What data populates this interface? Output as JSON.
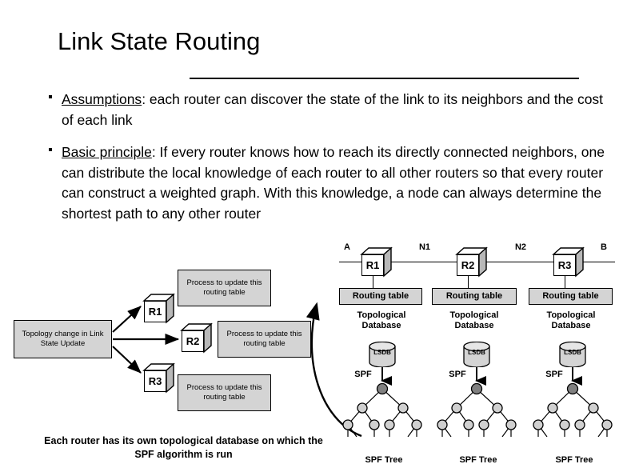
{
  "slide": {
    "title": "Link State Routing",
    "bullets": [
      {
        "lead": "Assumptions",
        "rest": ": each router can discover the state of the link to its neighbors and the cost of each link"
      },
      {
        "lead": "Basic principle",
        "rest": ": If every router knows how to reach its directly connected neighbors, one can distribute the local knowledge of each router to all other routers so that every router can construct a weighted graph. With this knowledge, a node can always determine the shortest path to any other router"
      }
    ]
  },
  "left_diagram": {
    "source_box": "Topology change in Link State Update",
    "routers": [
      {
        "label": "R1",
        "process": "Process to update this routing table"
      },
      {
        "label": "R2",
        "process": "Process to update this routing table"
      },
      {
        "label": "R3",
        "process": "Process to update this routing table"
      }
    ],
    "caption": "Each router has its own topological database on which the SPF algorithm is run"
  },
  "right_diagram": {
    "network_labels": [
      "A",
      "N1",
      "N2",
      "B"
    ],
    "routers": [
      "R1",
      "R2",
      "R3"
    ],
    "routing_table_label": "Routing table",
    "database_label": "Topological Database",
    "database_title_line1": "Topological",
    "database_title_line2": "Database",
    "lsdb_label": "LSDB",
    "spf_label": "SPF",
    "spf_tree_label": "SPF Tree",
    "columns": [
      {
        "router": "R1",
        "routing_table": "Routing table",
        "db_line1": "Topological",
        "db_line2": "Database",
        "lsdb": "LSDB",
        "spf": "SPF",
        "tree": "SPF Tree"
      },
      {
        "router": "R2",
        "routing_table": "Routing table",
        "db_line1": "Topological",
        "db_line2": "Database",
        "lsdb": "LSDB",
        "spf": "SPF",
        "tree": "SPF Tree"
      },
      {
        "router": "R3",
        "routing_table": "Routing table",
        "db_line1": "Topological",
        "db_line2": "Database",
        "lsdb": "LSDB",
        "spf": "SPF",
        "tree": "SPF Tree"
      }
    ]
  },
  "colors": {
    "box_fill": "#d4d4d4",
    "cube_side": "#b8b8b8",
    "node_fill": "#d0d0d0",
    "root_fill": "#808080",
    "line": "#000000"
  }
}
